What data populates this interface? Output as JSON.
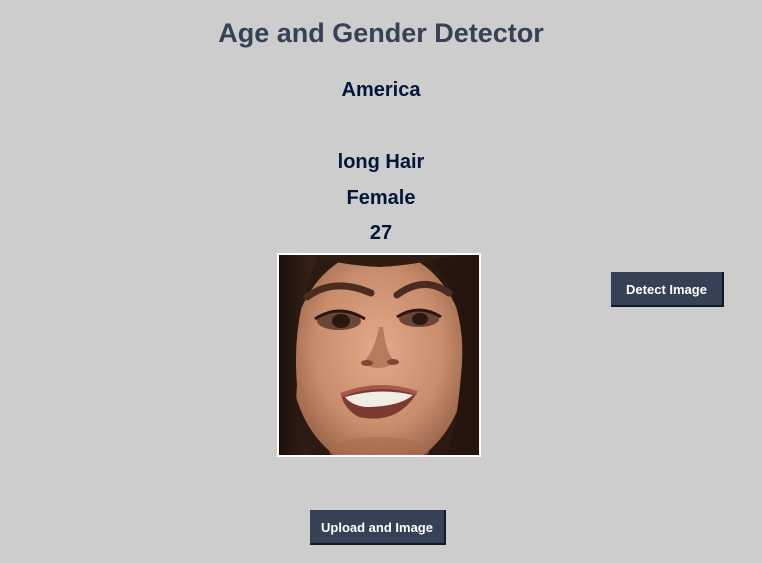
{
  "header": {
    "title": "Age and Gender Detector"
  },
  "results": {
    "country": "America",
    "hair": "long Hair",
    "gender": "Female",
    "age": "27"
  },
  "buttons": {
    "detect_label": "Detect Image",
    "upload_label": "Upload and Image"
  },
  "colors": {
    "background": "#cdcdcd",
    "title": "#364156",
    "result_text": "#011638",
    "button_bg": "#364156",
    "button_text": "#ffffff"
  }
}
